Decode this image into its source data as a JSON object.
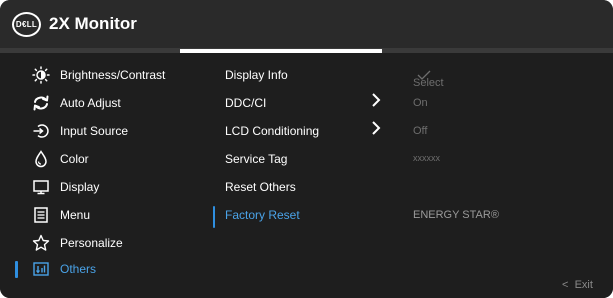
{
  "header": {
    "logo_text": "D€LL",
    "title": "2X Monitor"
  },
  "menu": [
    {
      "label": "Brightness/Contrast",
      "icon": "brightness-icon"
    },
    {
      "label": "Auto Adjust",
      "icon": "auto-adjust-icon"
    },
    {
      "label": "Input Source",
      "icon": "input-source-icon"
    },
    {
      "label": "Color",
      "icon": "color-icon"
    },
    {
      "label": "Display",
      "icon": "display-icon"
    },
    {
      "label": "Menu",
      "icon": "menu-icon"
    },
    {
      "label": "Personalize",
      "icon": "star-icon"
    },
    {
      "label": "Others",
      "icon": "others-icon",
      "selected": true
    }
  ],
  "submenu": [
    {
      "label": "Display Info"
    },
    {
      "label": "DDC/CI",
      "has_arrow": true
    },
    {
      "label": "LCD Conditioning",
      "has_arrow": true
    },
    {
      "label": "Service Tag"
    },
    {
      "label": "Reset Others"
    },
    {
      "label": "Factory Reset",
      "selected": true
    }
  ],
  "values": {
    "display_info": "Select",
    "ddc_ci": "On",
    "lcd_conditioning": "Off",
    "service_tag": "xxxxxx",
    "factory_reset": "ENERGY STAR®"
  },
  "footer": {
    "exit_label": "Exit"
  },
  "colors": {
    "background": "#1e1e1e",
    "header": "#2a2a2a",
    "accent": "#2f8fe0",
    "selected_text": "#4aa3e8",
    "dim_text": "#6e6e6e"
  }
}
